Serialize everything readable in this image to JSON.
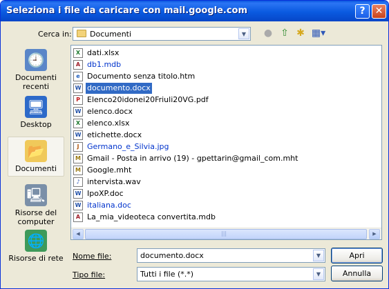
{
  "window": {
    "title": "Seleziona i file da caricare con mail.google.com",
    "help_label": "?",
    "close_label": "✕"
  },
  "lookin": {
    "label": "Cerca in:",
    "value": "Documenti"
  },
  "toolbar": {
    "back_icon": "●",
    "up_icon": "⇧",
    "new_folder_icon": "✱",
    "views_icon": "▦▾"
  },
  "places": [
    {
      "label": "Documenti recenti",
      "icon": "🕘"
    },
    {
      "label": "Desktop",
      "icon": "🖥"
    },
    {
      "label": "Documenti",
      "icon": "📂"
    },
    {
      "label": "Risorse del computer",
      "icon": "🖳"
    },
    {
      "label": "Risorse di rete",
      "icon": "🌐"
    }
  ],
  "files": [
    {
      "name": "dati.xlsx",
      "badge": "X"
    },
    {
      "name": "db1.mdb",
      "badge": "A"
    },
    {
      "name": "Documento senza titolo.htm",
      "badge": "e"
    },
    {
      "name": "documento.docx",
      "badge": "W"
    },
    {
      "name": "Elenco20idonei20Friuli20VG.pdf",
      "badge": "P"
    },
    {
      "name": "elenco.docx",
      "badge": "W"
    },
    {
      "name": "elenco.xlsx",
      "badge": "X"
    },
    {
      "name": "etichette.docx",
      "badge": "W"
    },
    {
      "name": "Germano_e_Silvia.jpg",
      "badge": "J"
    },
    {
      "name": "Gmail - Posta in arrivo (19) - gpettarin@gmail_com.mht",
      "badge": "M"
    },
    {
      "name": "Google.mht",
      "badge": "M"
    },
    {
      "name": "intervista.wav",
      "badge": "♪"
    },
    {
      "name": "IpoXP.doc",
      "badge": "W"
    },
    {
      "name": "italiana.doc",
      "badge": "W"
    },
    {
      "name": "La_mia_videoteca convertita.mdb",
      "badge": "A"
    }
  ],
  "scroll": {
    "left": "◀",
    "right": "▶",
    "grip": "|||"
  },
  "filename": {
    "label": "Nome file:",
    "value": "documento.docx"
  },
  "filetype": {
    "label": "Tipo file:",
    "value": "Tutti i file (*.*)"
  },
  "buttons": {
    "open": "Apri",
    "cancel": "Annulla"
  },
  "colors": {
    "selection": "#316ac5",
    "title_bar": "#0a5ae0",
    "face": "#ece9d8"
  }
}
